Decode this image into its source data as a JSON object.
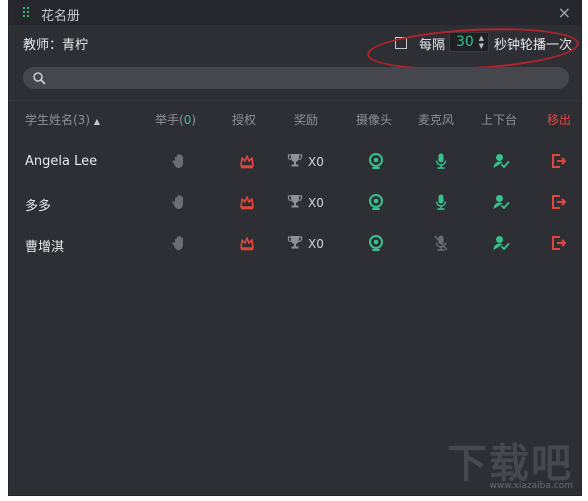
{
  "window": {
    "title": "花名册",
    "close_glyph": "×",
    "icons": [
      "grip-icon",
      "close-icon"
    ]
  },
  "teacher_bar": {
    "teacher_label": "教师：青柠",
    "rotation": {
      "checked": false,
      "every_label": "每隔",
      "interval": "30",
      "suffix": "秒钟轮播一次"
    }
  },
  "search": {
    "placeholder": "",
    "value": "",
    "icon": "search-icon"
  },
  "table": {
    "columns": {
      "name": "学生姓名(3)",
      "hand_label": "举手(",
      "hand_count": "0",
      "hand_close": ")",
      "authorize": "授权",
      "reward": "奖励",
      "camera": "摄像头",
      "microphone": "麦克风",
      "stage": "上下台",
      "remove": "移出"
    },
    "rows": [
      {
        "name": "Angela Lee",
        "reward_count": "X0",
        "mic_on": true
      },
      {
        "name": "多多",
        "reward_count": "X0",
        "mic_on": true
      },
      {
        "name": "曹增淇",
        "reward_count": "X0",
        "mic_on": false
      }
    ]
  },
  "colors": {
    "panel_bg": "#2e2f35",
    "accent_green": "#36c28a",
    "danger_red": "#e2453c",
    "muted_gray": "#6c6d72",
    "annotation_red": "#b4232a"
  },
  "watermark": {
    "text": "下载吧",
    "url": "www.xiazaiba.com"
  }
}
